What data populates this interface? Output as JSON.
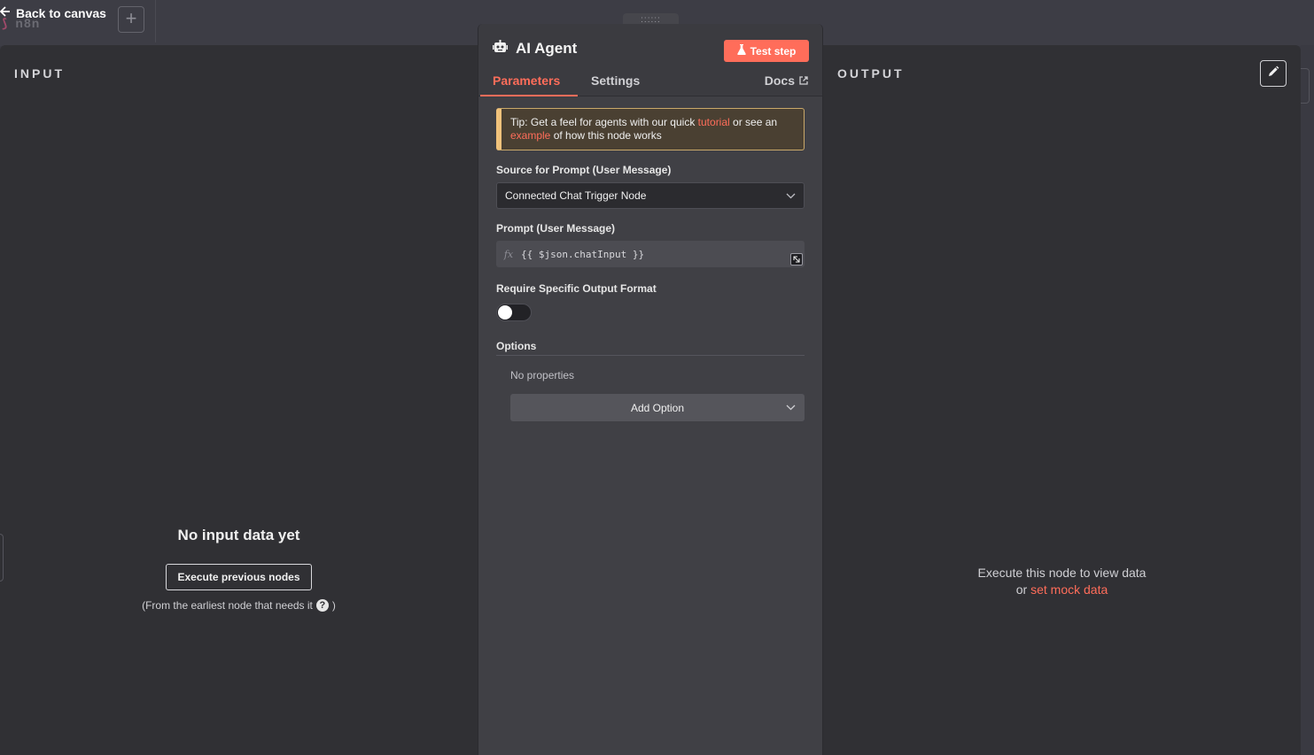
{
  "topbar": {
    "back_label": "Back to canvas",
    "ghost_logo": "n8n",
    "plus_glyph": "+"
  },
  "input_panel": {
    "title": "INPUT",
    "empty_title": "No input data yet",
    "execute_button": "Execute previous nodes",
    "hint_before": "(From the earliest node that needs it",
    "hint_after": ")"
  },
  "output_panel": {
    "title": "OUTPUT",
    "empty_line1": "Execute this node to view data",
    "empty_or": "or",
    "mock_link": "set mock data"
  },
  "node": {
    "drag_handle": "::::::",
    "title": "AI Agent",
    "test_button": "Test step",
    "tabs": [
      {
        "label": "Parameters",
        "active": true
      },
      {
        "label": "Settings",
        "active": false
      }
    ],
    "docs_label": "Docs",
    "tip": {
      "prefix": "Tip: Get a feel for agents with our quick",
      "link1": "tutorial",
      "middle": "or see an",
      "link2": "example",
      "suffix": "of how this node works"
    },
    "source_label": "Source for Prompt (User Message)",
    "source_value": "Connected Chat Trigger Node",
    "prompt_label": "Prompt (User Message)",
    "prompt_fx": "fx",
    "prompt_value": "{{ $json.chatInput }}",
    "output_format_label": "Require Specific Output Format",
    "output_format_enabled": false,
    "options_label": "Options",
    "no_properties": "No properties",
    "add_option": "Add Option"
  },
  "colors": {
    "accent": "#ff6d5a",
    "panel_bg": "#303034",
    "node_bg": "#404045",
    "tip_border": "#f0c27b"
  },
  "icons": {
    "back": "arrow-left-icon",
    "robot": "robot-icon",
    "flask": "flask-icon",
    "external": "external-link-icon",
    "pencil": "pencil-icon",
    "chevron": "chevron-down-icon",
    "help": "question-circle-icon",
    "expand": "expand-icon"
  }
}
